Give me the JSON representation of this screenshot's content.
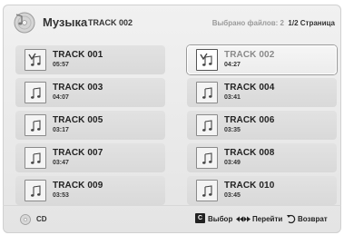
{
  "header": {
    "title": "Музыка",
    "subtitle": "TRACK 002",
    "selected_info": "Выбрано файлов: 2",
    "page_info": "1/2 Страница"
  },
  "tracks": [
    {
      "name": "TRACK 001",
      "time": "05:57",
      "icon": "music-note-icon",
      "checked": true
    },
    {
      "name": "TRACK 002",
      "time": "04:27",
      "icon": "music-note-icon",
      "checked": true,
      "focused": true
    },
    {
      "name": "TRACK 003",
      "time": "04:07",
      "icon": "music-note-icon"
    },
    {
      "name": "TRACK 004",
      "time": "03:41",
      "icon": "music-note-icon"
    },
    {
      "name": "TRACK 005",
      "time": "03:17",
      "icon": "music-note-icon"
    },
    {
      "name": "TRACK 006",
      "time": "03:35",
      "icon": "music-note-icon"
    },
    {
      "name": "TRACK 007",
      "time": "03:47",
      "icon": "music-note-icon"
    },
    {
      "name": "TRACK 008",
      "time": "03:49",
      "icon": "music-note-icon"
    },
    {
      "name": "TRACK 009",
      "time": "03:53",
      "icon": "music-note-icon"
    },
    {
      "name": "TRACK 010",
      "time": "03:45",
      "icon": "music-note-icon"
    }
  ],
  "footer": {
    "source_label": "CD",
    "select_key": "C",
    "select_label": "Выбор",
    "go_label": "Перейти",
    "back_label": "Возврат"
  },
  "colors": {
    "background": "#e8e8e8",
    "tile": "#dcdcdc",
    "focus_tile": "#f3f3f3",
    "text": "#222222"
  }
}
